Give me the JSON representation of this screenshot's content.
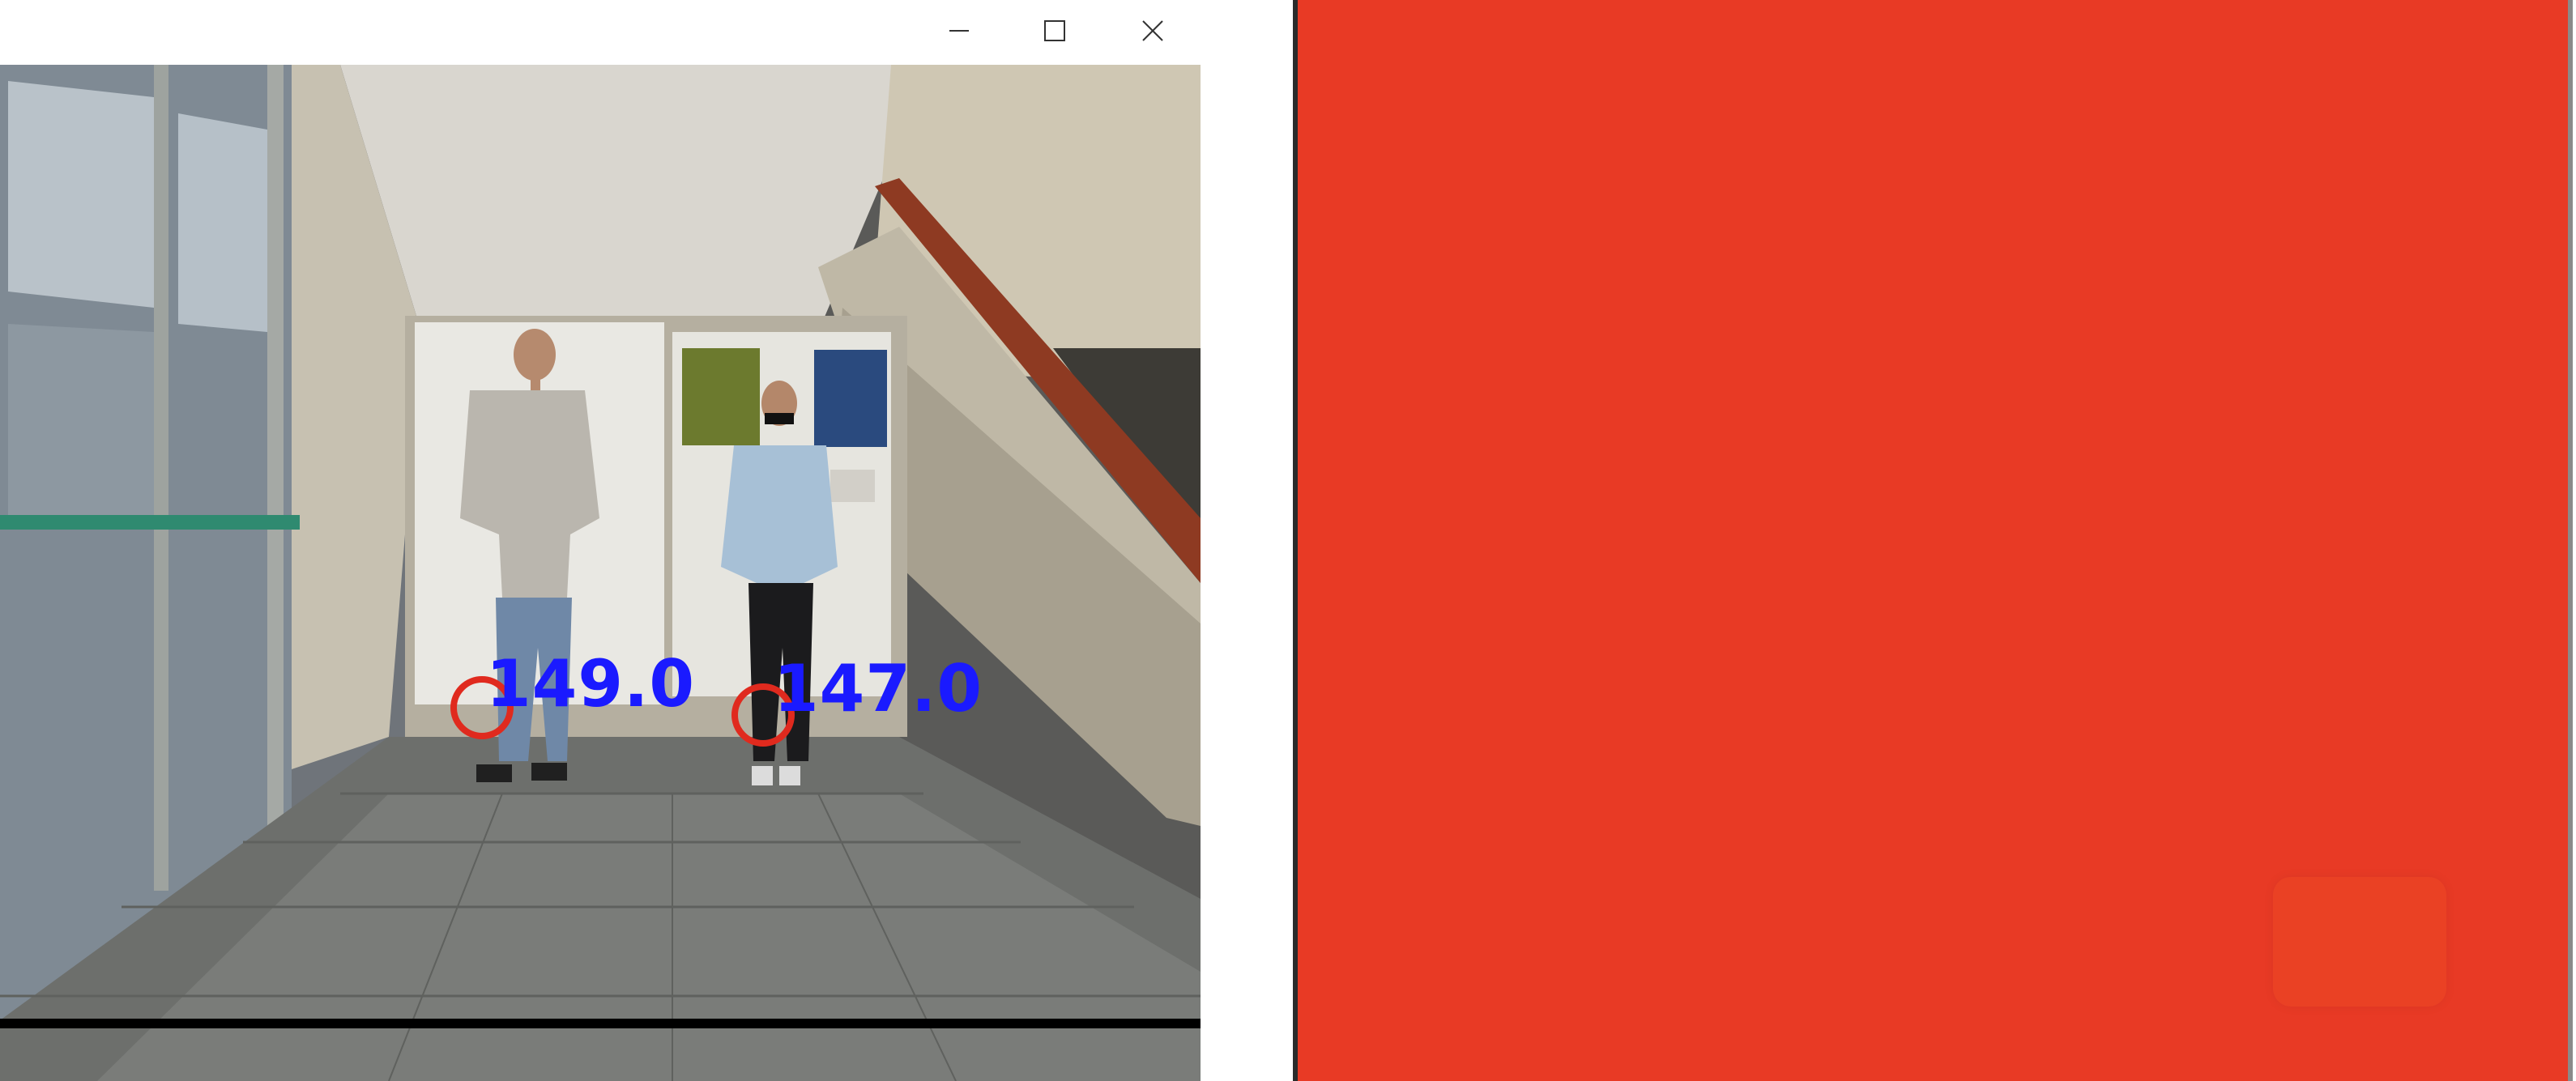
{
  "window_controls": {
    "minimize": "minimize-icon",
    "maximize": "maximize-icon",
    "close": "close-icon"
  },
  "detections": [
    {
      "label": "149.0"
    },
    {
      "label": "147.0"
    }
  ],
  "colors": {
    "label_color": "#1a1aff",
    "marker_color": "#e02a1e",
    "red_panel": "#e83a25",
    "red_patch": "#ea4124"
  }
}
